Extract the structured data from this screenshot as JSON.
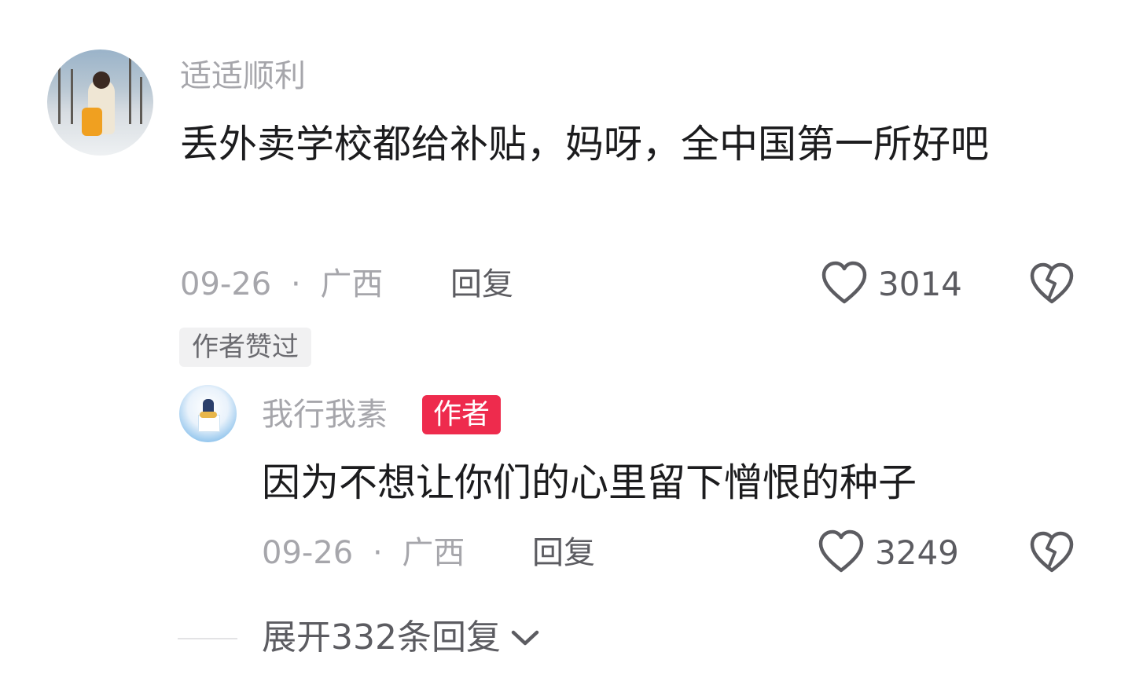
{
  "comment": {
    "username": "适适顺利",
    "text": "丢外卖学校都给补贴，妈呀，全中国第一所好吧",
    "date": "09-26",
    "separator": "·",
    "location": "广西",
    "reply_label": "回复",
    "like_count": "3014",
    "author_liked_tag": "作者赞过"
  },
  "reply": {
    "username": "我行我素",
    "author_badge": "作者",
    "text": "因为不想让你们的心里留下憎恨的种子",
    "date": "09-26",
    "separator": "·",
    "location": "广西",
    "reply_label": "回复",
    "like_count": "3249"
  },
  "expand": {
    "label": "展开332条回复"
  },
  "icons": {
    "like": "heart-outline-icon",
    "dislike": "broken-heart-icon",
    "expand": "chevron-down-icon"
  },
  "colors": {
    "author_badge_bg": "#ee2b4d",
    "secondary_text": "#a6a6ab",
    "primary_text": "#1c1c1e"
  }
}
